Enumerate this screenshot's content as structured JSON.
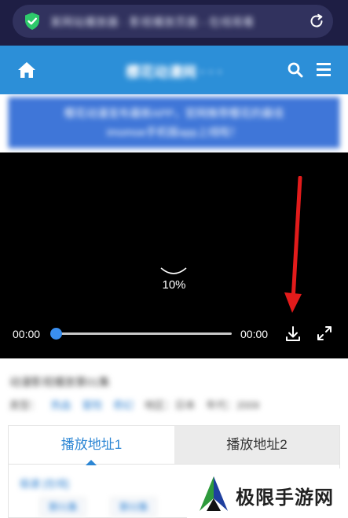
{
  "browser": {
    "url": "某网站播放器 · 影视播放页面 - 在线观看",
    "secure_icon": "shield-check-icon",
    "reload_icon": "reload-icon"
  },
  "header": {
    "title": "樱花动漫网 · · ·",
    "home_icon": "home-icon",
    "search_icon": "search-icon",
    "menu_icon": "menu-icon",
    "bg_color": "#2c8fd8"
  },
  "notice": {
    "line1": "樱花动漫发布最新APP，官网推荐樱花的最佳",
    "line2": "imomoe手机版app上线啦！"
  },
  "player": {
    "loading_percent": "10%",
    "current_time": "00:00",
    "duration": "00:00",
    "progress": 0,
    "download_icon": "download-icon",
    "fullscreen_icon": "fullscreen-icon",
    "accent_color": "#3a8ff0"
  },
  "info": {
    "title": "动漫影视播放第01集",
    "genre_label": "类型：",
    "genre_tags": [
      "热血",
      "冒险",
      "奇幻"
    ],
    "region": "地区：日本",
    "year": "年代：2009"
  },
  "tabs": [
    {
      "label": "播放地址1",
      "active": true
    },
    {
      "label": "播放地址2",
      "active": false
    }
  ],
  "episodes": {
    "heading": "极速 [在线]",
    "items": [
      "第01集",
      "第02集"
    ]
  },
  "watermark": {
    "text": "极限手游网",
    "logo_icon": "jixian-logo-icon"
  }
}
